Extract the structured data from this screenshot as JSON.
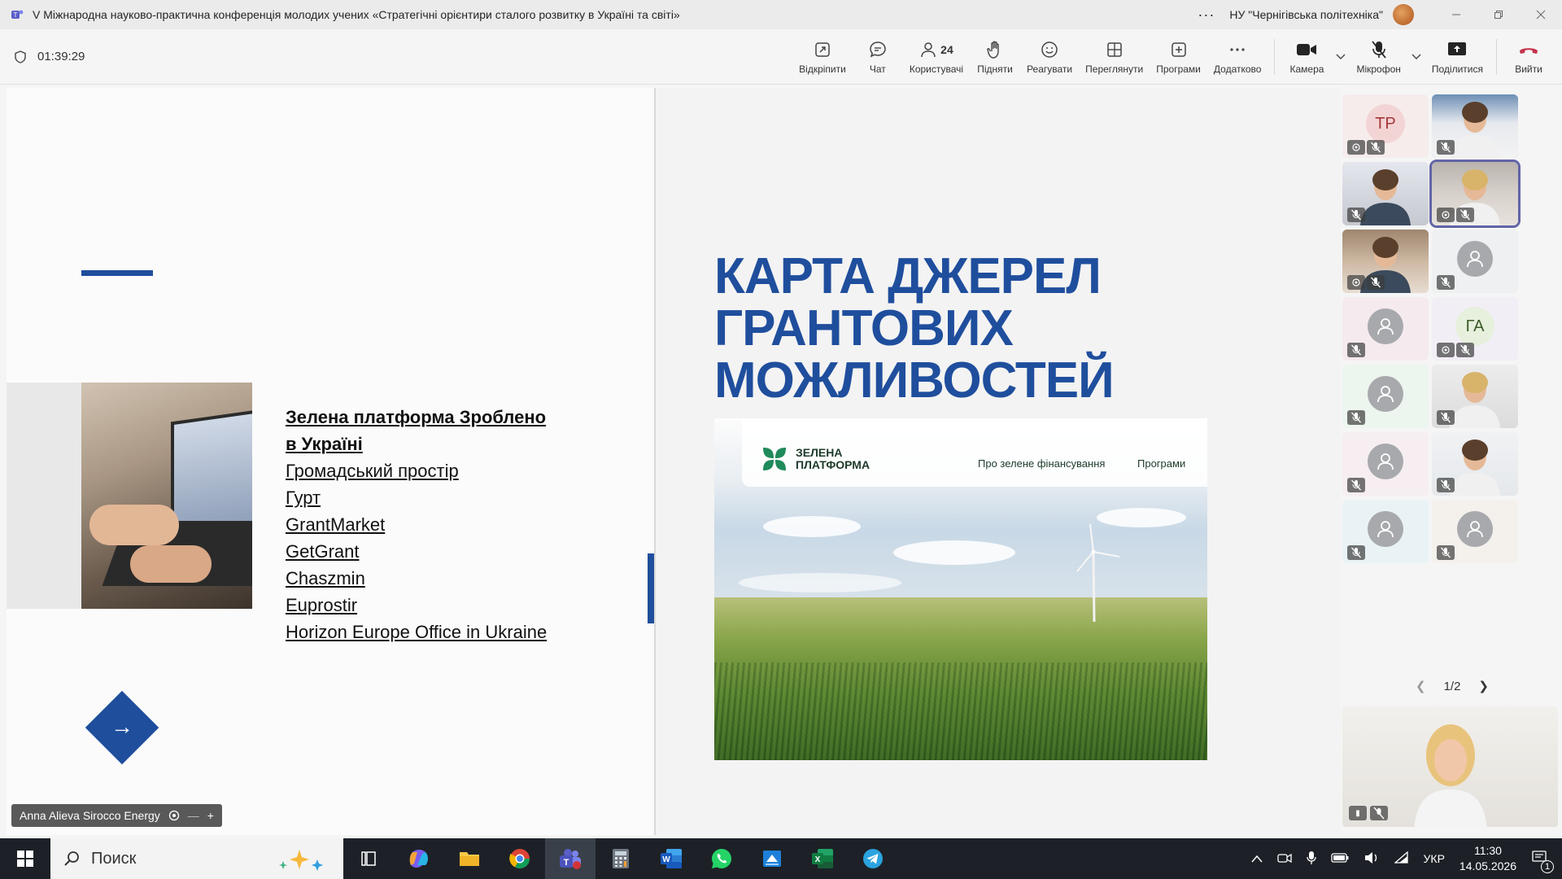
{
  "window": {
    "title": "V Міжнародна науково-практична конференція молодих учених «Стратегічні орієнтири сталого розвитку в Україні та світі»",
    "org": "НУ \"Чернігівська політехніка\"",
    "more": "···"
  },
  "meeting": {
    "timer": "01:39:29",
    "participants_count": "24",
    "buttons": {
      "popout": "Відкріпити",
      "chat": "Чат",
      "people": "Користувачі",
      "raise": "Підняти",
      "react": "Реагувати",
      "view": "Переглянути",
      "apps": "Програми",
      "more": "Додатково",
      "camera": "Камера",
      "mic": "Мікрофон",
      "share": "Поділитися",
      "leave": "Вийти"
    }
  },
  "slide": {
    "links": [
      "Зелена платформа Зроблено",
      "в Україні",
      "Громадський простір",
      "Гурт",
      "GrantMarket",
      "GetGrant",
      "Chaszmin",
      "Euprostir",
      "Horizon Europe Office in Ukraine"
    ],
    "arrow": "→",
    "heading": [
      "КАРТА ДЖЕРЕЛ",
      "ГРАНТОВИХ",
      "МОЖЛИВОСТЕЙ"
    ],
    "website": {
      "logo_line1": "ЗЕЛЕНА",
      "logo_line2": "ПЛАТФОРМА",
      "nav1": "Про зелене фінансування",
      "nav2": "Програми"
    }
  },
  "presenter": {
    "name": "Anna Alieva Sirocco Energy",
    "minus": "—",
    "plus": "+"
  },
  "gallery": {
    "tiles": [
      {
        "initials": "TP",
        "bg": "#f6ecec",
        "circle": "#f3d4d4",
        "type": "initials"
      },
      {
        "type": "video",
        "bg": "#5a7fa8"
      },
      {
        "type": "video",
        "bg": "#d9dbe3"
      },
      {
        "type": "video",
        "bg": "#c9c7c5"
      },
      {
        "type": "video",
        "bg": "#b9a08c"
      },
      {
        "type": "avatar",
        "bg": "#eef0f2"
      },
      {
        "type": "avatar",
        "bg": "#f5eaee"
      },
      {
        "initials": "ГА",
        "bg": "#f2eef6",
        "circle": "#e6f0dc",
        "type": "initials"
      },
      {
        "type": "avatar",
        "bg": "#edf5ef"
      },
      {
        "type": "video",
        "bg": "#d7d9dc"
      },
      {
        "type": "avatar",
        "bg": "#f6eef0"
      },
      {
        "type": "video",
        "bg": "#e9ecef"
      },
      {
        "type": "avatar",
        "bg": "#e9f3f6"
      },
      {
        "type": "avatar",
        "bg": "#f4f0ec"
      }
    ],
    "page": "1/2"
  },
  "taskbar": {
    "search_placeholder": "Поиск",
    "lang": "УКР",
    "time": "11:30",
    "date": "14.05.2026",
    "notifications": "1"
  }
}
